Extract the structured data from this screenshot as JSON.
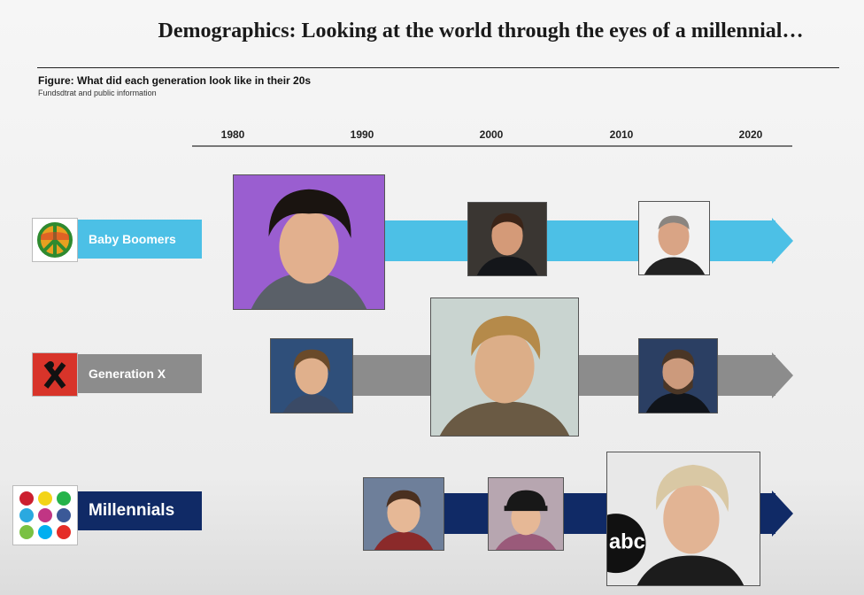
{
  "title": "Demographics: Looking at the world through the eyes of a millennial…",
  "figure_caption": "Figure: What did each generation look like in their 20s",
  "source": "Fundsdtrat and public information",
  "axis_years": [
    "1980",
    "1990",
    "2000",
    "2010",
    "2020"
  ],
  "generations": [
    {
      "label": "Baby Boomers",
      "color": "#4cc0e6",
      "icon": "peace-sign-icon"
    },
    {
      "label": "Generation X",
      "color": "#8c8c8c",
      "icon": "x-figure-icon"
    },
    {
      "label": "Millennials",
      "color": "#102a66",
      "icon": "social-media-apps-icon"
    }
  ],
  "photo_texts": {
    "abc": "abc"
  }
}
